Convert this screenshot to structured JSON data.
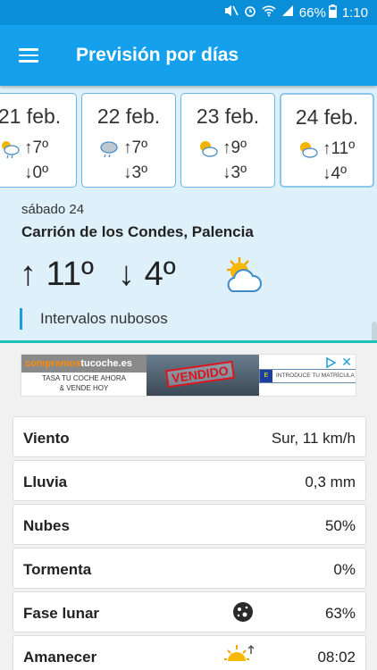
{
  "status_bar": {
    "icons": [
      "mute-icon",
      "alarm-icon",
      "wifi-icon",
      "signal-icon",
      "battery-icon"
    ],
    "battery": "66%",
    "time": "1:10"
  },
  "app_bar": {
    "menu_icon": "hamburger-menu-icon",
    "title": "Previsión por días"
  },
  "days": [
    {
      "date": "21 feb.",
      "icon": "sun-cloud-rain-icon",
      "max": "7º",
      "min": "0º"
    },
    {
      "date": "22 feb.",
      "icon": "cloud-rain-icon",
      "max": "7º",
      "min": "3º"
    },
    {
      "date": "23 feb.",
      "icon": "sun-cloud-icon",
      "max": "9º",
      "min": "3º"
    },
    {
      "date": "24 feb.",
      "icon": "sun-cloud-icon",
      "max": "11º",
      "min": "4º"
    }
  ],
  "selected_day": {
    "day_name": "sábado 24",
    "location": "Carrión de los Condes, Palencia",
    "max": "11º",
    "min": "4º",
    "icon": "sun-behind-cloud-icon",
    "description": "Intervalos nubosos"
  },
  "ad": {
    "brand_pre": "compramos",
    "brand_post": "tucoche.es",
    "line1": "TASA TU COCHE AHORA",
    "line2": "& VENDE HOY",
    "stamp": "VENDIDO",
    "plate_text": "INTRODUCE TU MATRÍCULA",
    "close": "✕"
  },
  "details": [
    {
      "label": "Viento",
      "value": "Sur, 11 km/h"
    },
    {
      "label": "Lluvia",
      "value": "0,3 mm"
    },
    {
      "label": "Nubes",
      "value": "50%"
    },
    {
      "label": "Tormenta",
      "value": "0%"
    },
    {
      "label": "Fase lunar",
      "value": "63%",
      "icon": "moon-phase-icon"
    },
    {
      "label": "Amanecer",
      "value": "08:02",
      "icon": "sunrise-icon"
    }
  ],
  "colors": {
    "statusbar": "#0a8ed8",
    "appbar": "#15a0ee",
    "panel": "#def1fb",
    "accent": "#1b9be0",
    "teal_divider": "#1cc1b7"
  }
}
